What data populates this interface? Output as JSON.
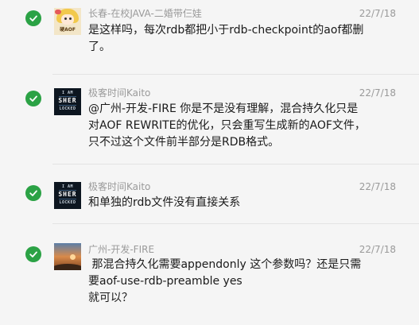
{
  "messages": [
    {
      "sender": "长春-在校JAVA-二婚带仨娃",
      "time": "22/7/18",
      "avatar": "cartoon-girl-avatar",
      "avatar_caption": "硬AOF",
      "lines": [
        "是这样吗，每次rdb都把小于rdb-checkpoint的aof都删",
        "了。"
      ]
    },
    {
      "sender": "极客时间Kaito",
      "time": "22/7/18",
      "avatar": "kaito-avatar",
      "avatar_lines": [
        "I AM",
        "SHER",
        "LOCKED"
      ],
      "lines": [
        "@广州-开发-FIRE 你是不是没有理解，混合持久化只是",
        "对AOF REWRITE的优化，只会重写生成新的AOF文件，",
        "只不过这个文件前半部分是RDB格式。"
      ]
    },
    {
      "sender": "极客时间Kaito",
      "time": "22/7/18",
      "avatar": "kaito-avatar",
      "avatar_lines": [
        "I AM",
        "SHER",
        "LOCKED"
      ],
      "lines": [
        "和单独的rdb文件没有直接关系"
      ]
    },
    {
      "sender": "广州-开发-FIRE",
      "time": "22/7/18",
      "avatar": "sunset-avatar",
      "lines": [
        " 那混合持久化需要appendonly 这个参数吗？还是只需",
        "要aof-use-rdb-preamble yes",
        "就可以？"
      ]
    }
  ],
  "colors": {
    "check": "#2ba245",
    "name": "#9a9a9a",
    "text": "#1a1a1a",
    "background": "#f5f5f5",
    "divider": "#e3e3e3"
  }
}
